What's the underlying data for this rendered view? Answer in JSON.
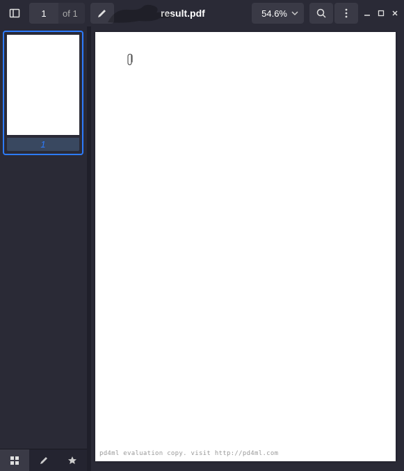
{
  "toolbar": {
    "current_page": "1",
    "total_pages_label": "of 1",
    "title": "result.pdf",
    "zoom_label": "54.6%"
  },
  "sidebar": {
    "thumbnails": [
      {
        "page_label": "1"
      }
    ]
  },
  "document": {
    "watermark": "pd4ml evaluation copy. visit http://pd4ml.com"
  }
}
